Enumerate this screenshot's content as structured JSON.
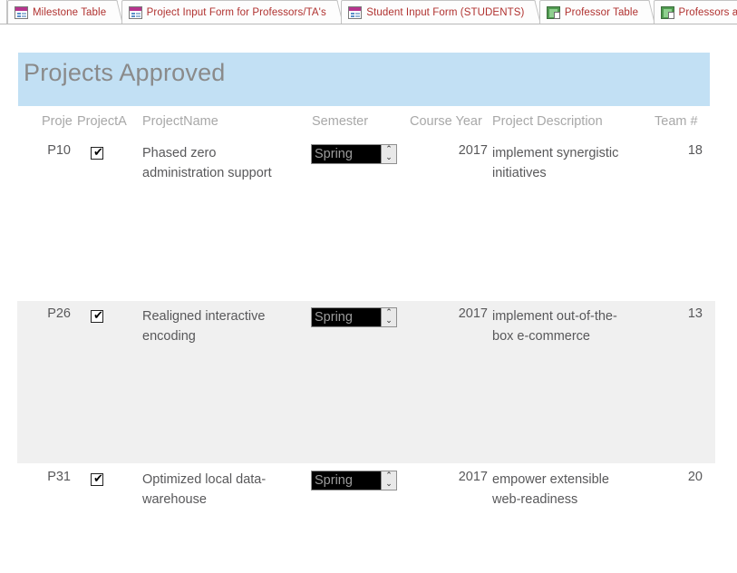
{
  "tabs": [
    {
      "label": "Milestone Table",
      "icon": "access-form-icon",
      "active": false
    },
    {
      "label": "Project Input Form for Professors/TA's",
      "icon": "access-form-icon",
      "active": false
    },
    {
      "label": "Student Input Form (STUDENTS)",
      "icon": "access-form-icon",
      "active": false
    },
    {
      "label": "Professor Table",
      "icon": "access-query-icon",
      "active": false
    },
    {
      "label": "Professors and TA",
      "icon": "access-query-icon",
      "active": false
    }
  ],
  "report": {
    "title": "Projects Approved",
    "banner_color": "#c2e0f4",
    "headers": {
      "project_id": "Proje",
      "project_approved": "ProjectA",
      "project_name": "ProjectName",
      "semester": "Semester",
      "course_year": "Course Year",
      "project_description": "Project Description",
      "team": "Team #"
    },
    "rows": [
      {
        "project_id": "P10",
        "approved": "✔",
        "project_name": "Phased zero administration support",
        "semester": "Spring",
        "course_year": "2017",
        "project_description": "implement synergistic initiatives",
        "team": "18"
      },
      {
        "project_id": "P26",
        "approved": "✔",
        "project_name": "Realigned interactive encoding",
        "semester": "Spring",
        "course_year": "2017",
        "project_description": "implement out-of-the-box e-commerce",
        "team": "13"
      },
      {
        "project_id": "P31",
        "approved": "✔",
        "project_name": "Optimized local data-warehouse",
        "semester": "Spring",
        "course_year": "2017",
        "project_description": "empower extensible web-readiness",
        "team": "20"
      }
    ],
    "spinner": {
      "up": "⌃",
      "down": "⌄"
    }
  }
}
